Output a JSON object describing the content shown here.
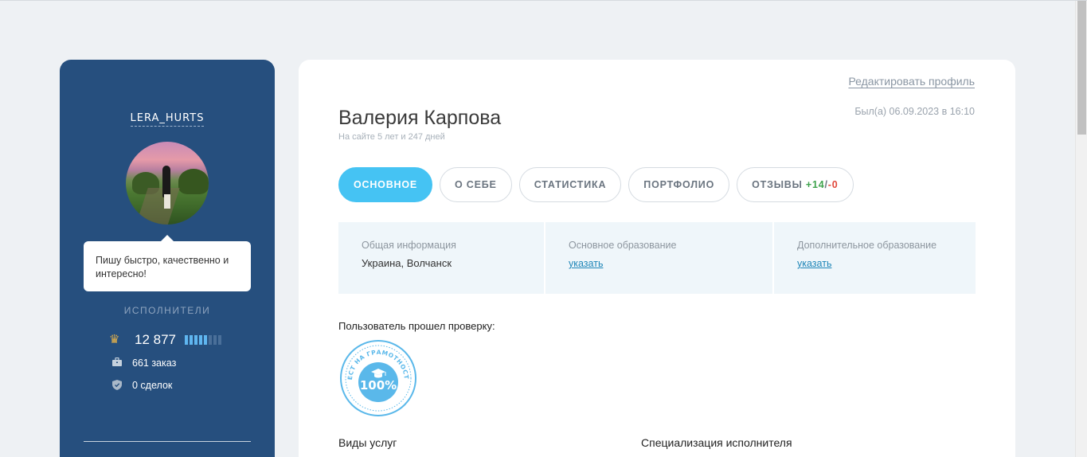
{
  "sidebar": {
    "username": "LERA_HURTS",
    "bio": "Пишу быстро, качественно и интересно!",
    "role": "ИСПОЛНИТЕЛИ",
    "rating": "12 877",
    "rating_level": {
      "filled": 5,
      "total": 8
    },
    "orders": "661 заказ",
    "deals": "0 сделок",
    "icons": {
      "rating": "crown-icon",
      "orders": "briefcase-icon",
      "deals": "shield-icon"
    }
  },
  "profile": {
    "edit_link": "Редактировать профиль",
    "last_seen": "Был(а) 06.09.2023 в 16:10",
    "name": "Валерия Карпова",
    "since": "На сайте 5 лет и 247 дней"
  },
  "tabs": [
    {
      "label": "ОСНОВНОЕ",
      "active": true
    },
    {
      "label": "О СЕБЕ",
      "active": false
    },
    {
      "label": "СТАТИСТИКА",
      "active": false
    },
    {
      "label": "ПОРТФОЛИО",
      "active": false
    },
    {
      "label": "ОТЗЫВЫ",
      "positive": "+14",
      "separator": "/",
      "negative": "-0",
      "active": false
    }
  ],
  "info": {
    "general": {
      "label": "Общая информация",
      "value": "Украина, Волчанск"
    },
    "education": {
      "label": "Основное образование",
      "link": "указать"
    },
    "extra_education": {
      "label": "Дополнительное образование",
      "link": "указать"
    }
  },
  "verification": {
    "title": "Пользователь прошел проверку:",
    "badge_text": "ТЕСТ НА ГРАМОТНОСТЬ",
    "badge_value": "100%"
  },
  "sections": {
    "services": "Виды услуг",
    "specialization": "Специализация исполнителя"
  },
  "colors": {
    "sidebar_bg": "#264f7e",
    "accent": "#45c3f3",
    "positive": "#3fa34d",
    "negative": "#e1483c"
  }
}
